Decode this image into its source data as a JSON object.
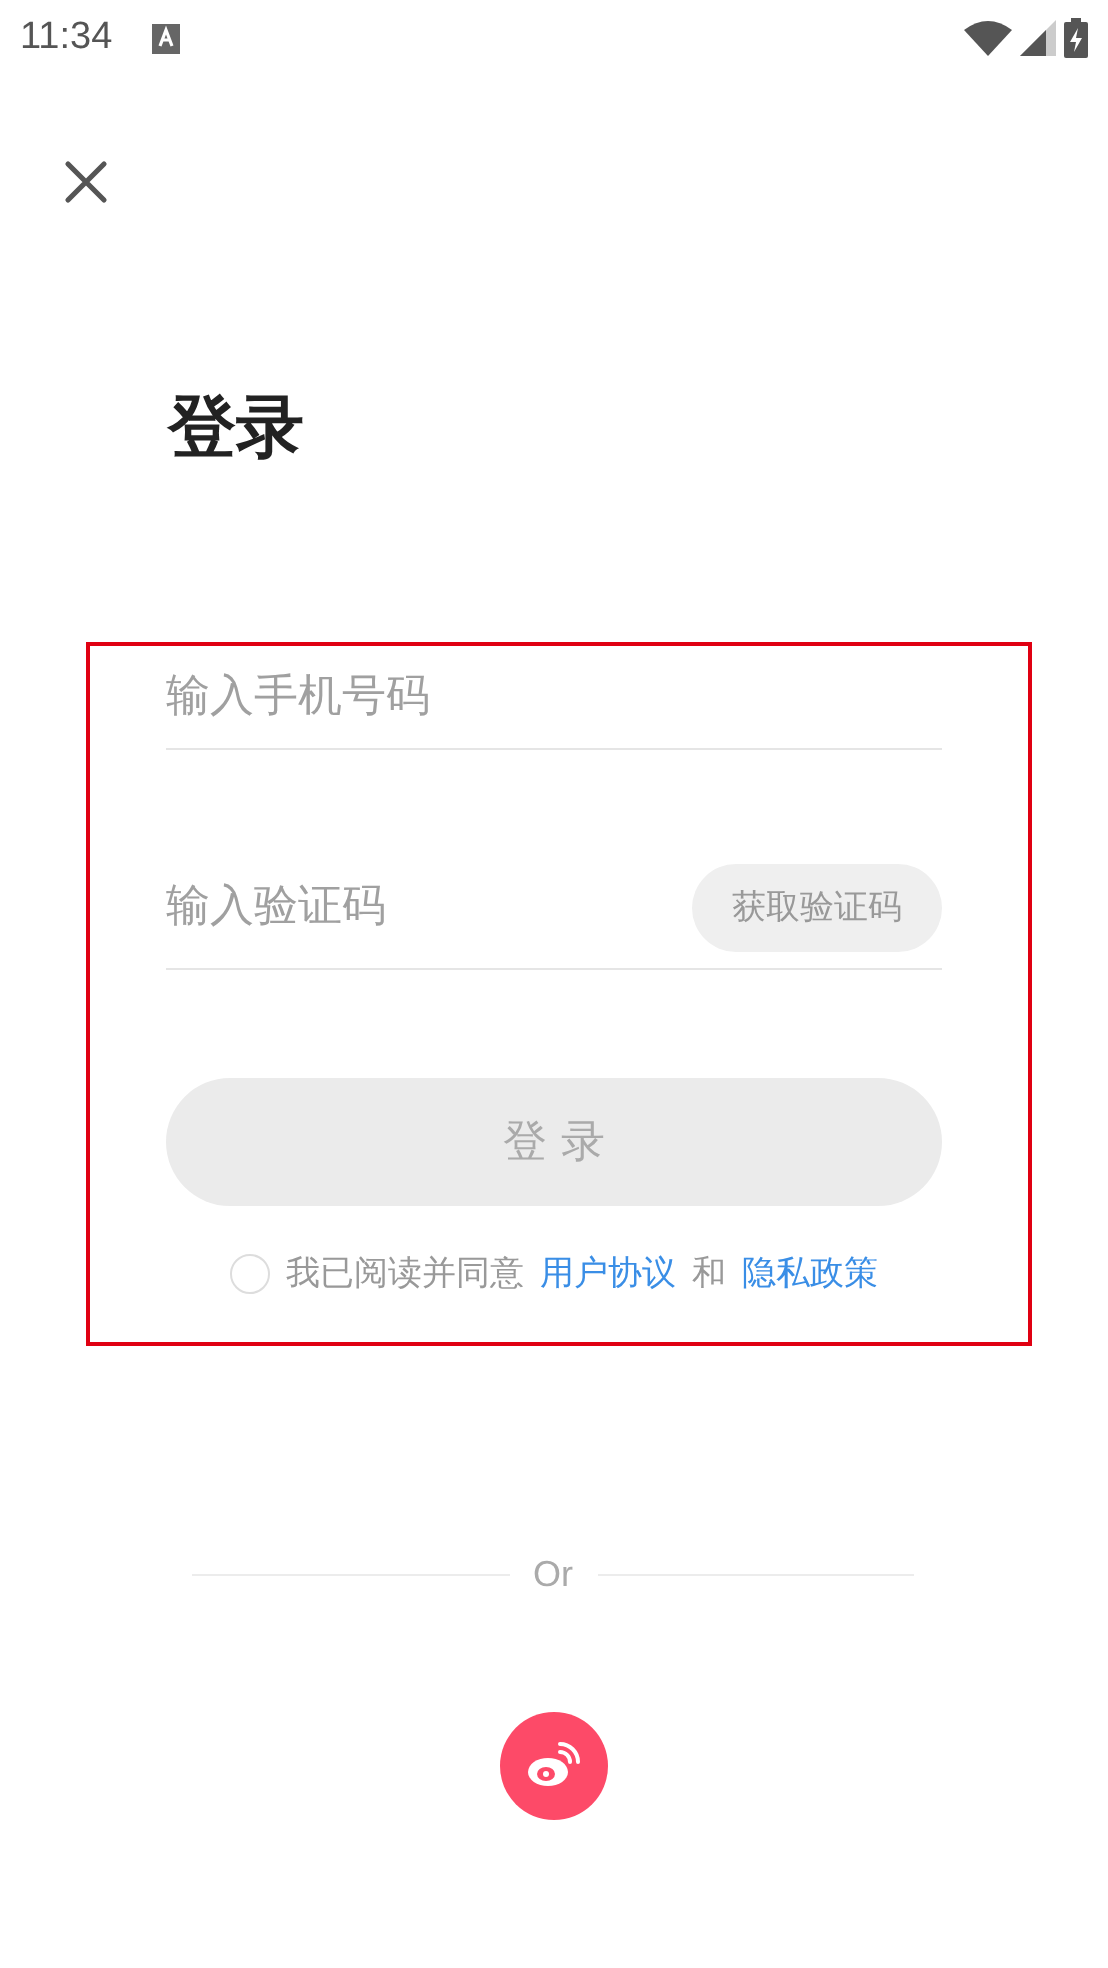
{
  "status_bar": {
    "time": "11:34"
  },
  "title": "登录",
  "phone_field": {
    "placeholder": "输入手机号码"
  },
  "code_field": {
    "placeholder": "输入验证码",
    "get_code_button": "获取验证码"
  },
  "login_button": {
    "label": "登 录",
    "disabled": true
  },
  "agreement": {
    "checked": false,
    "text": "我已阅读并同意",
    "link_1": "用户协议",
    "joiner": "和",
    "link_2": "隐私政策"
  },
  "divider_label": "Or"
}
